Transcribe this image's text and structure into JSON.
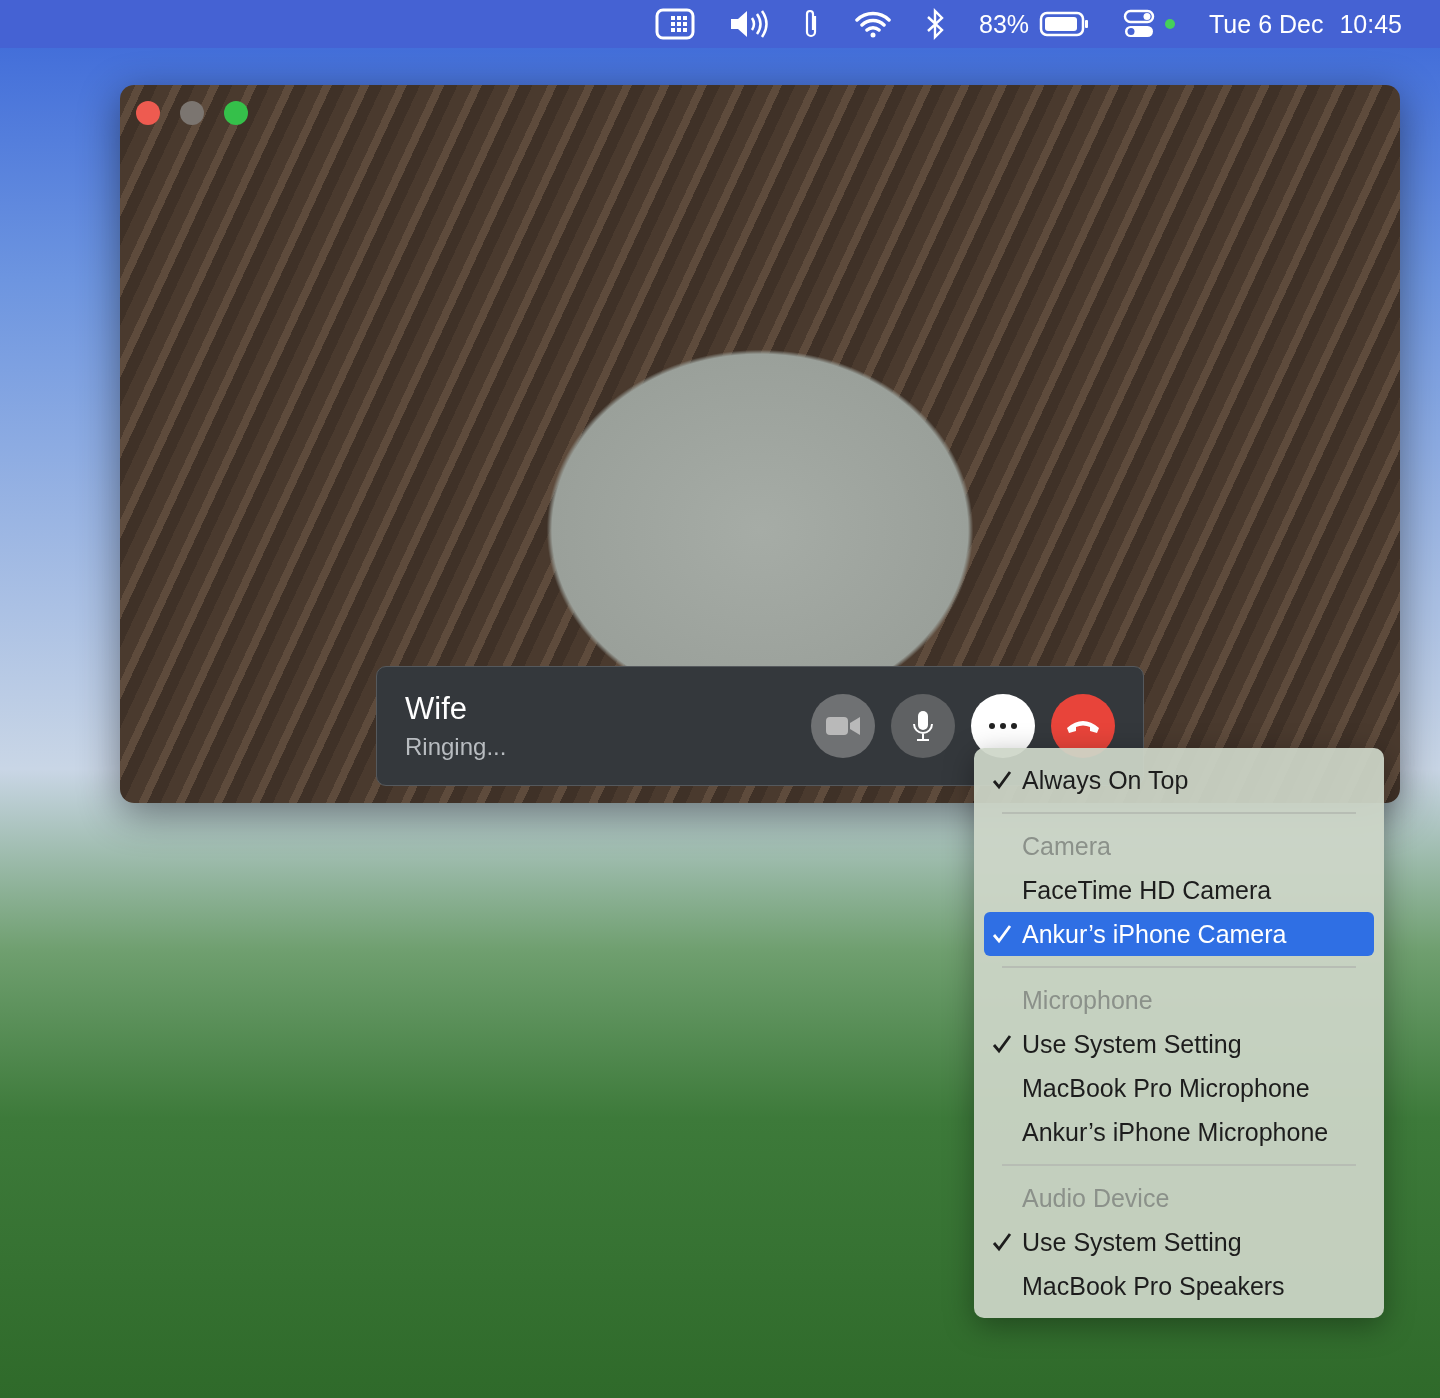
{
  "menu_bar": {
    "battery_percent": "83%",
    "date": "Tue 6 Dec",
    "time": "10:45"
  },
  "call_window": {
    "caller": "Wife",
    "status": "Ringing...",
    "buttons": [
      {
        "kind": "video",
        "active": false
      },
      {
        "kind": "microphone",
        "active": false
      },
      {
        "kind": "more",
        "active": true
      },
      {
        "kind": "end",
        "active": false
      }
    ]
  },
  "options_menu": {
    "items": [
      {
        "kind": "item",
        "label": "Always On Top",
        "checked": true,
        "selected": false
      },
      {
        "kind": "separator"
      },
      {
        "kind": "header",
        "label": "Camera"
      },
      {
        "kind": "item",
        "label": "FaceTime HD Camera",
        "checked": false,
        "selected": false
      },
      {
        "kind": "item",
        "label": "Ankur’s iPhone Camera",
        "checked": true,
        "selected": true
      },
      {
        "kind": "separator"
      },
      {
        "kind": "header",
        "label": "Microphone"
      },
      {
        "kind": "item",
        "label": "Use System Setting",
        "checked": true,
        "selected": false
      },
      {
        "kind": "item",
        "label": "MacBook Pro Microphone",
        "checked": false,
        "selected": false
      },
      {
        "kind": "item",
        "label": "Ankur’s iPhone Microphone",
        "checked": false,
        "selected": false
      },
      {
        "kind": "separator"
      },
      {
        "kind": "header",
        "label": "Audio Device"
      },
      {
        "kind": "item",
        "label": "Use System Setting",
        "checked": true,
        "selected": false
      },
      {
        "kind": "item",
        "label": "MacBook Pro Speakers",
        "checked": false,
        "selected": false
      }
    ]
  }
}
